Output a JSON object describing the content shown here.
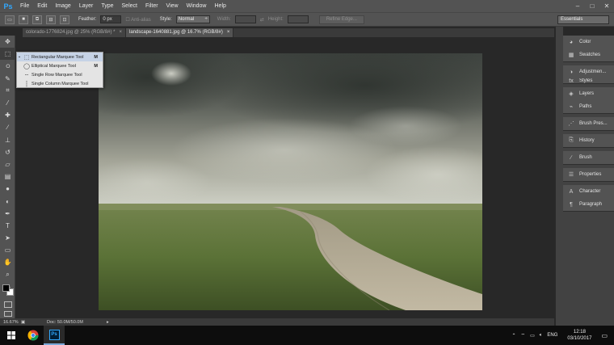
{
  "app": {
    "logo": "Ps"
  },
  "menu": [
    "File",
    "Edit",
    "Image",
    "Layer",
    "Type",
    "Select",
    "Filter",
    "View",
    "Window",
    "Help"
  ],
  "window_controls": {
    "minimize": "‒",
    "maximize": "□",
    "close": "✕"
  },
  "options_bar": {
    "feather_label": "Feather:",
    "feather_value": "0 px",
    "antialias_label": "Anti-alias",
    "style_label": "Style:",
    "style_value": "Normal",
    "width_label": "Width:",
    "height_label": "Height:",
    "refine_edge_label": "Refine Edge...",
    "workspace_value": "Essentials"
  },
  "tabs": [
    {
      "label": "colorado-1776824.jpg @ 25% (RGB/8#) *",
      "close": "×"
    },
    {
      "label": "landscape-1640881.jpg @ 16.7% (RGB/8#)",
      "close": "×"
    }
  ],
  "flyout": {
    "items": [
      {
        "label": "Rectangular Marquee Tool",
        "shortcut": "M",
        "icon": "rect-marquee-icon"
      },
      {
        "label": "Elliptical Marquee Tool",
        "shortcut": "M",
        "icon": "ellipse-marquee-icon"
      },
      {
        "label": "Single Row Marquee Tool",
        "shortcut": "",
        "icon": "single-row-icon"
      },
      {
        "label": "Single Column Marquee Tool",
        "shortcut": "",
        "icon": "single-column-icon"
      }
    ]
  },
  "status": {
    "zoom": "16.67%",
    "doc": "Doc: 50.0M/50.0M"
  },
  "panels": {
    "group1": [
      "Color",
      "Swatches"
    ],
    "group2": [
      "Adjustmen...",
      "Styles"
    ],
    "group3": [
      "Layers",
      "Paths"
    ],
    "group4": [
      "Brush Pres..."
    ],
    "group5": [
      "History"
    ],
    "group6": [
      "Brush"
    ],
    "group7": [
      "Properties"
    ],
    "group8": [
      "Character",
      "Paragraph"
    ]
  },
  "taskbar": {
    "language": "ENG",
    "time": "12:18",
    "date": "03/10/2017"
  },
  "colors": {
    "accent": "#31a8ff",
    "chrome": "#535353",
    "canvas_bg": "#282828"
  }
}
